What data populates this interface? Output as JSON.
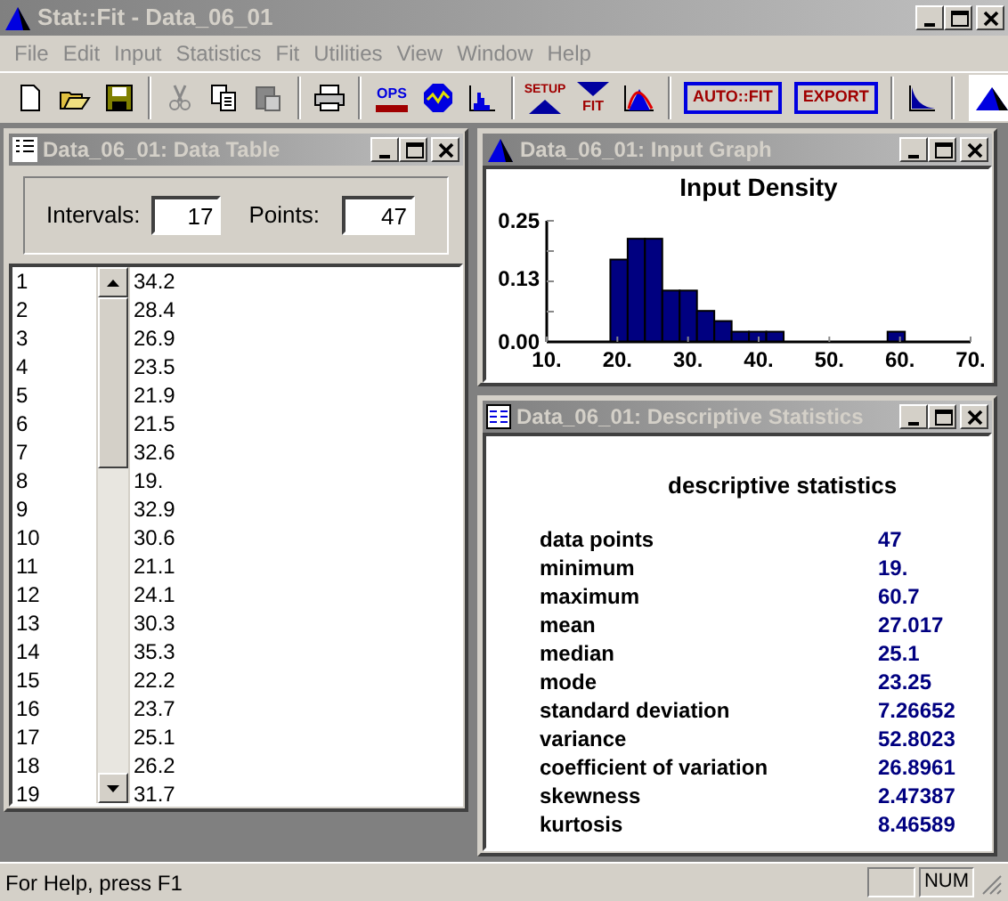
{
  "window": {
    "title": "Stat::Fit - Data_06_01"
  },
  "menu": [
    "File",
    "Edit",
    "Input",
    "Statistics",
    "Fit",
    "Utilities",
    "View",
    "Window",
    "Help"
  ],
  "toolbar": {
    "ops": "OPS",
    "setup": "SETUP",
    "fit": "FIT",
    "autofit": "AUTO::FIT",
    "export": "EXPORT"
  },
  "data_table": {
    "title": "Data_06_01: Data Table",
    "intervals_label": "Intervals:",
    "intervals": "17",
    "points_label": "Points:",
    "points": "47",
    "rows": [
      {
        "index": "1",
        "value": "34.2"
      },
      {
        "index": "2",
        "value": "28.4"
      },
      {
        "index": "3",
        "value": "26.9"
      },
      {
        "index": "4",
        "value": "23.5"
      },
      {
        "index": "5",
        "value": "21.9"
      },
      {
        "index": "6",
        "value": "21.5"
      },
      {
        "index": "7",
        "value": "32.6"
      },
      {
        "index": "8",
        "value": "19."
      },
      {
        "index": "9",
        "value": "32.9"
      },
      {
        "index": "10",
        "value": "30.6"
      },
      {
        "index": "11",
        "value": "21.1"
      },
      {
        "index": "12",
        "value": "24.1"
      },
      {
        "index": "13",
        "value": "30.3"
      },
      {
        "index": "14",
        "value": "35.3"
      },
      {
        "index": "15",
        "value": "22.2"
      },
      {
        "index": "16",
        "value": "23.7"
      },
      {
        "index": "17",
        "value": "25.1"
      },
      {
        "index": "18",
        "value": "26.2"
      },
      {
        "index": "19",
        "value": "31.7"
      }
    ]
  },
  "input_graph": {
    "title": "Data_06_01: Input Graph",
    "chart_data": {
      "type": "bar",
      "title": "Input Density",
      "x": [
        20.23,
        22.68,
        25.13,
        27.59,
        30.04,
        32.49,
        34.95,
        37.4,
        39.85,
        42.31,
        44.76,
        47.21,
        49.67,
        52.12,
        54.57,
        57.03,
        59.47
      ],
      "series": [
        {
          "color": "#000080",
          "values": [
            0.17,
            0.213,
            0.213,
            0.106,
            0.106,
            0.064,
            0.043,
            0.021,
            0.021,
            0.021,
            0,
            0,
            0,
            0,
            0,
            0,
            0.021
          ]
        }
      ],
      "xlim": [
        10,
        70
      ],
      "ylim": [
        0,
        0.25
      ],
      "xticks": [
        {
          "value": 10,
          "label": "10."
        },
        {
          "value": 20,
          "label": "20."
        },
        {
          "value": 30,
          "label": "30."
        },
        {
          "value": 40,
          "label": "40."
        },
        {
          "value": 50,
          "label": "50."
        },
        {
          "value": 60,
          "label": "60."
        },
        {
          "value": 70,
          "label": "70."
        }
      ],
      "yticks": [
        {
          "value": 0,
          "label": "0.00"
        },
        {
          "value": 0.13,
          "label": "0.13"
        },
        {
          "value": 0.25,
          "label": "0.25"
        }
      ]
    }
  },
  "statistics": {
    "title": "Data_06_01: Descriptive Statistics",
    "heading": "descriptive statistics",
    "rows": [
      {
        "label": "data points",
        "value": "47"
      },
      {
        "label": "minimum",
        "value": "19."
      },
      {
        "label": "maximum",
        "value": "60.7"
      },
      {
        "label": "mean",
        "value": "27.017"
      },
      {
        "label": "median",
        "value": "25.1"
      },
      {
        "label": "mode",
        "value": "23.25"
      },
      {
        "label": "standard deviation",
        "value": "7.26652"
      },
      {
        "label": "variance",
        "value": "52.8023"
      },
      {
        "label": "coefficient of variation",
        "value": "26.8961"
      },
      {
        "label": "skewness",
        "value": "2.47387"
      },
      {
        "label": "kurtosis",
        "value": "8.46589"
      }
    ]
  },
  "status_bar": {
    "text": "For Help, press F1",
    "indicator": "NUM"
  }
}
